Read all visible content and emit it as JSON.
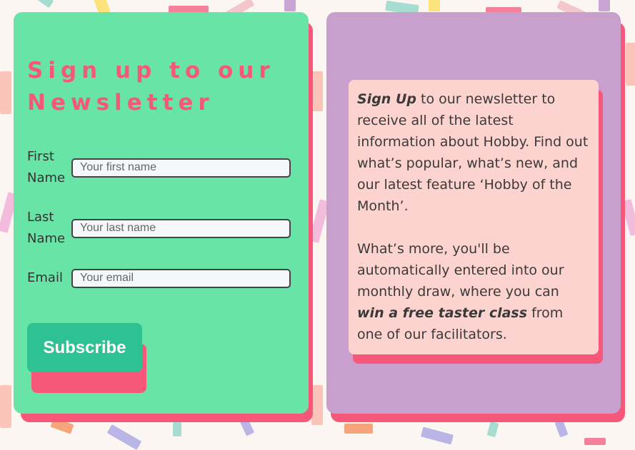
{
  "newsletter": {
    "heading": "Sign up to our Newsletter",
    "first_name": {
      "label": "First Name",
      "placeholder": "Your first name",
      "value": ""
    },
    "last_name": {
      "label": "Last Name",
      "placeholder": "Your last name",
      "value": ""
    },
    "email": {
      "label": "Email",
      "placeholder": "Your email",
      "value": ""
    },
    "subscribe_label": "Subscribe"
  },
  "info": {
    "p1_strong": "Sign Up",
    "p1_text": " to our newsletter to receive all of the latest information about Hobby. Find out what’s popular, what’s new, and our latest feature ‘Hobby of the Month’.",
    "p2_text_a": "What’s more, you'll be automatically entered into our monthly draw, where you can ",
    "p2_strong": "win a free taster class",
    "p2_text_b": " from one of our facilitators."
  },
  "colors": {
    "page_background": "#fcf6f2",
    "form_card": "#68e4a6",
    "info_card": "#c9a0cd",
    "info_box": "#fdd3cf",
    "accent_pink": "#f7587a",
    "button": "#2ec191"
  }
}
